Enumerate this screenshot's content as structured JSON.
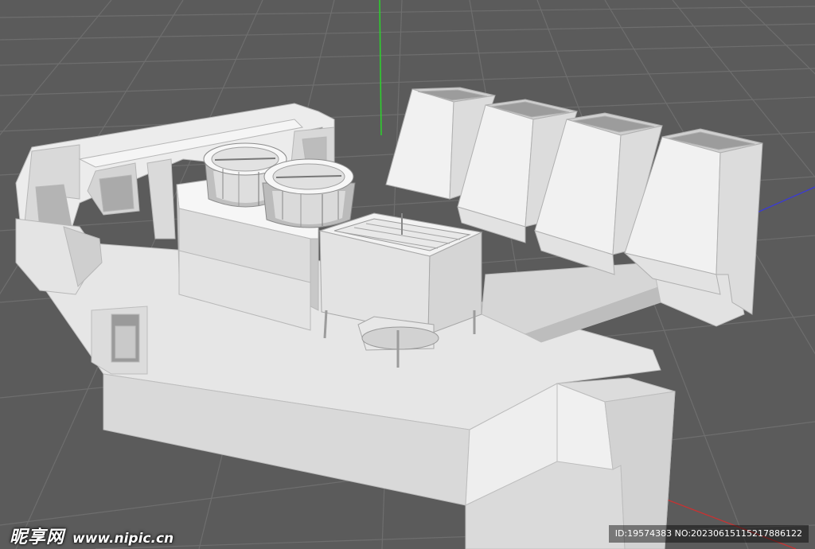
{
  "viewport": {
    "background": "#5b5b5b",
    "grid_color": "#6d6d6d",
    "model_color": "#e9e9e9",
    "axis_colors": {
      "y": "#2bd42b",
      "x": "#d03030",
      "z": "#3030d0"
    }
  },
  "model": {
    "components": [
      "frame-structure",
      "fan-cylinder",
      "fan-cylinder",
      "radiator-unit",
      "duct",
      "duct",
      "duct",
      "duct",
      "base-platform",
      "channel"
    ]
  },
  "watermark": {
    "brand": "昵享网",
    "url": "www.nipic.cn",
    "id_text": "ID:19574383 NO:20230615115217886122"
  }
}
